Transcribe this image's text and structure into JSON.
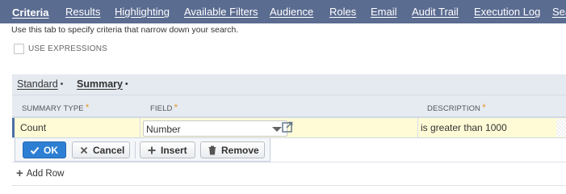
{
  "tabs": [
    {
      "label": "Criteria",
      "active": true
    },
    {
      "label": "Results",
      "active": false
    },
    {
      "label": "Highlighting",
      "active": false
    },
    {
      "label": "Available Filters",
      "active": false
    },
    {
      "label": "Audience",
      "active": false
    },
    {
      "label": "Roles",
      "active": false
    },
    {
      "label": "Email",
      "active": false
    },
    {
      "label": "Audit Trail",
      "active": false
    },
    {
      "label": "Execution Log",
      "active": false
    },
    {
      "label": "Sea",
      "active": false
    }
  ],
  "help_text": "Use this tab to specify criteria that narrow down your search.",
  "use_expressions": {
    "label": "USE EXPRESSIONS",
    "checked": false
  },
  "subtabs": [
    {
      "label": "Standard",
      "marker": "•",
      "active": false
    },
    {
      "label": "Summary",
      "marker": "•",
      "active": true
    }
  ],
  "grid": {
    "required_marker": "*",
    "columns": {
      "summary_type": "SUMMARY TYPE",
      "field": "FIELD",
      "description": "DESCRIPTION"
    },
    "row": {
      "summary_type": "Count",
      "field": "Number",
      "description": "is greater than 1000"
    }
  },
  "buttons": {
    "ok": "OK",
    "cancel": "Cancel",
    "insert": "Insert",
    "remove": "Remove"
  },
  "add_row": {
    "icon": "+",
    "label": "Add Row"
  },
  "icons": {
    "ok": "check-icon",
    "cancel": "x-icon",
    "insert": "plus-icon",
    "remove": "trash-icon",
    "open": "open-external-icon",
    "dropdown": "caret-down-icon"
  },
  "colors": {
    "tab_bar": "#5b6c91",
    "subtab_bar": "#e5eaf1",
    "edit_row": "#fffbd6",
    "primary_button": "#2d7fd3",
    "required": "#e39b2c"
  }
}
